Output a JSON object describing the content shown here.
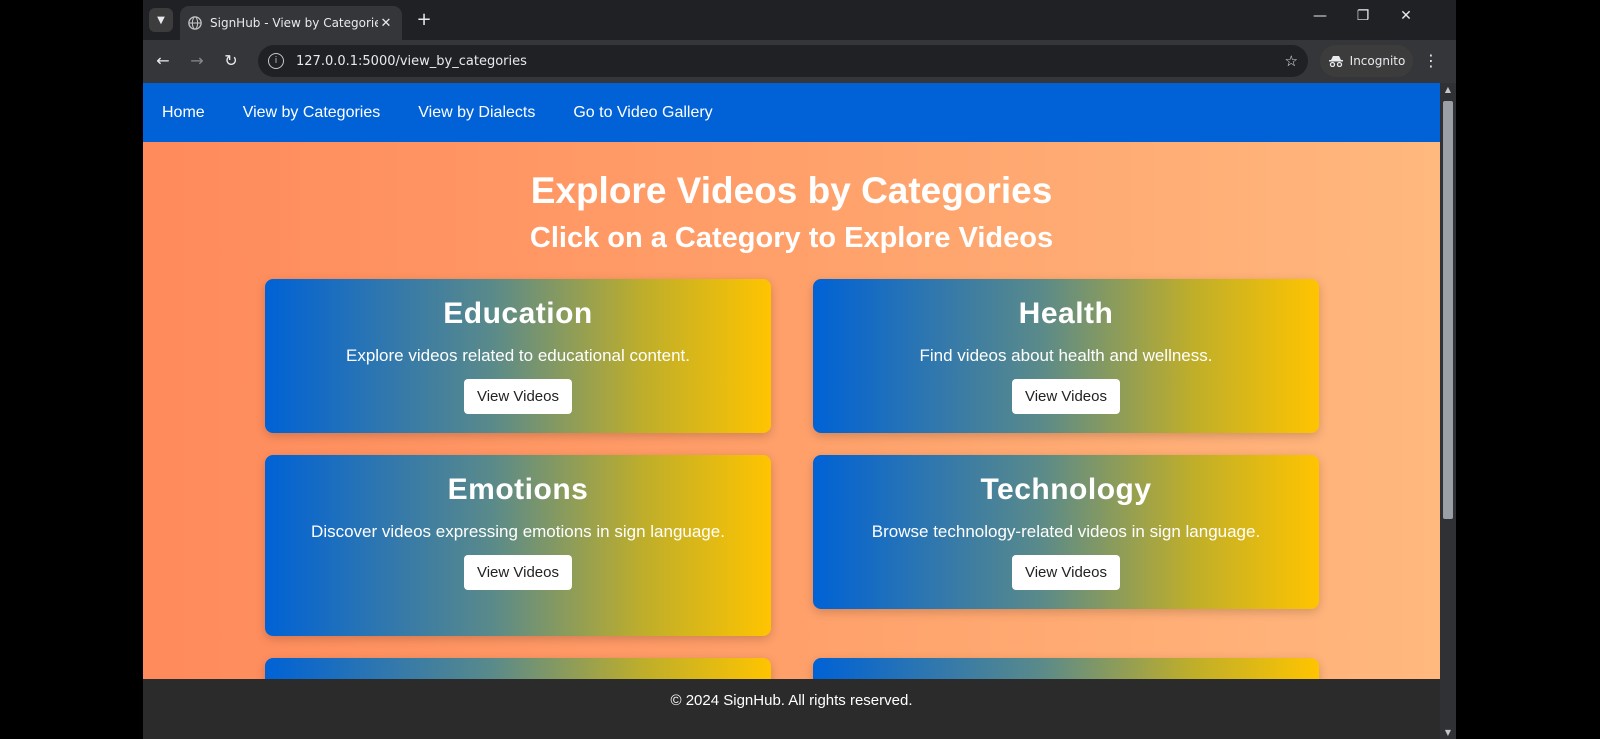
{
  "browser": {
    "tab_title": "SignHub - View by Categories",
    "url": "127.0.0.1:5000/view_by_categories",
    "incognito_label": "Incognito"
  },
  "nav": {
    "items": [
      "Home",
      "View by Categories",
      "View by Dialects",
      "Go to Video Gallery"
    ]
  },
  "hero": {
    "title": "Explore Videos by Categories",
    "subtitle": "Click on a Category to Explore Videos"
  },
  "categories": [
    {
      "title": "Education",
      "description": "Explore videos related to educational content.",
      "button": "View Videos"
    },
    {
      "title": "Health",
      "description": "Find videos about health and wellness.",
      "button": "View Videos"
    },
    {
      "title": "Emotions",
      "description": "Discover videos expressing emotions in sign language.",
      "button": "View Videos"
    },
    {
      "title": "Technology",
      "description": "Browse technology-related videos in sign language.",
      "button": "View Videos"
    }
  ],
  "footer": {
    "text": "© 2024 SignHub. All rights reserved."
  },
  "colors": {
    "nav_bg": "#0062d6",
    "page_bg_start": "#ff8a5b",
    "page_bg_end": "#ffb87e",
    "card_gradient_start": "#0062d6",
    "card_gradient_end": "#ffc400",
    "footer_bg": "#2b2b2b"
  }
}
